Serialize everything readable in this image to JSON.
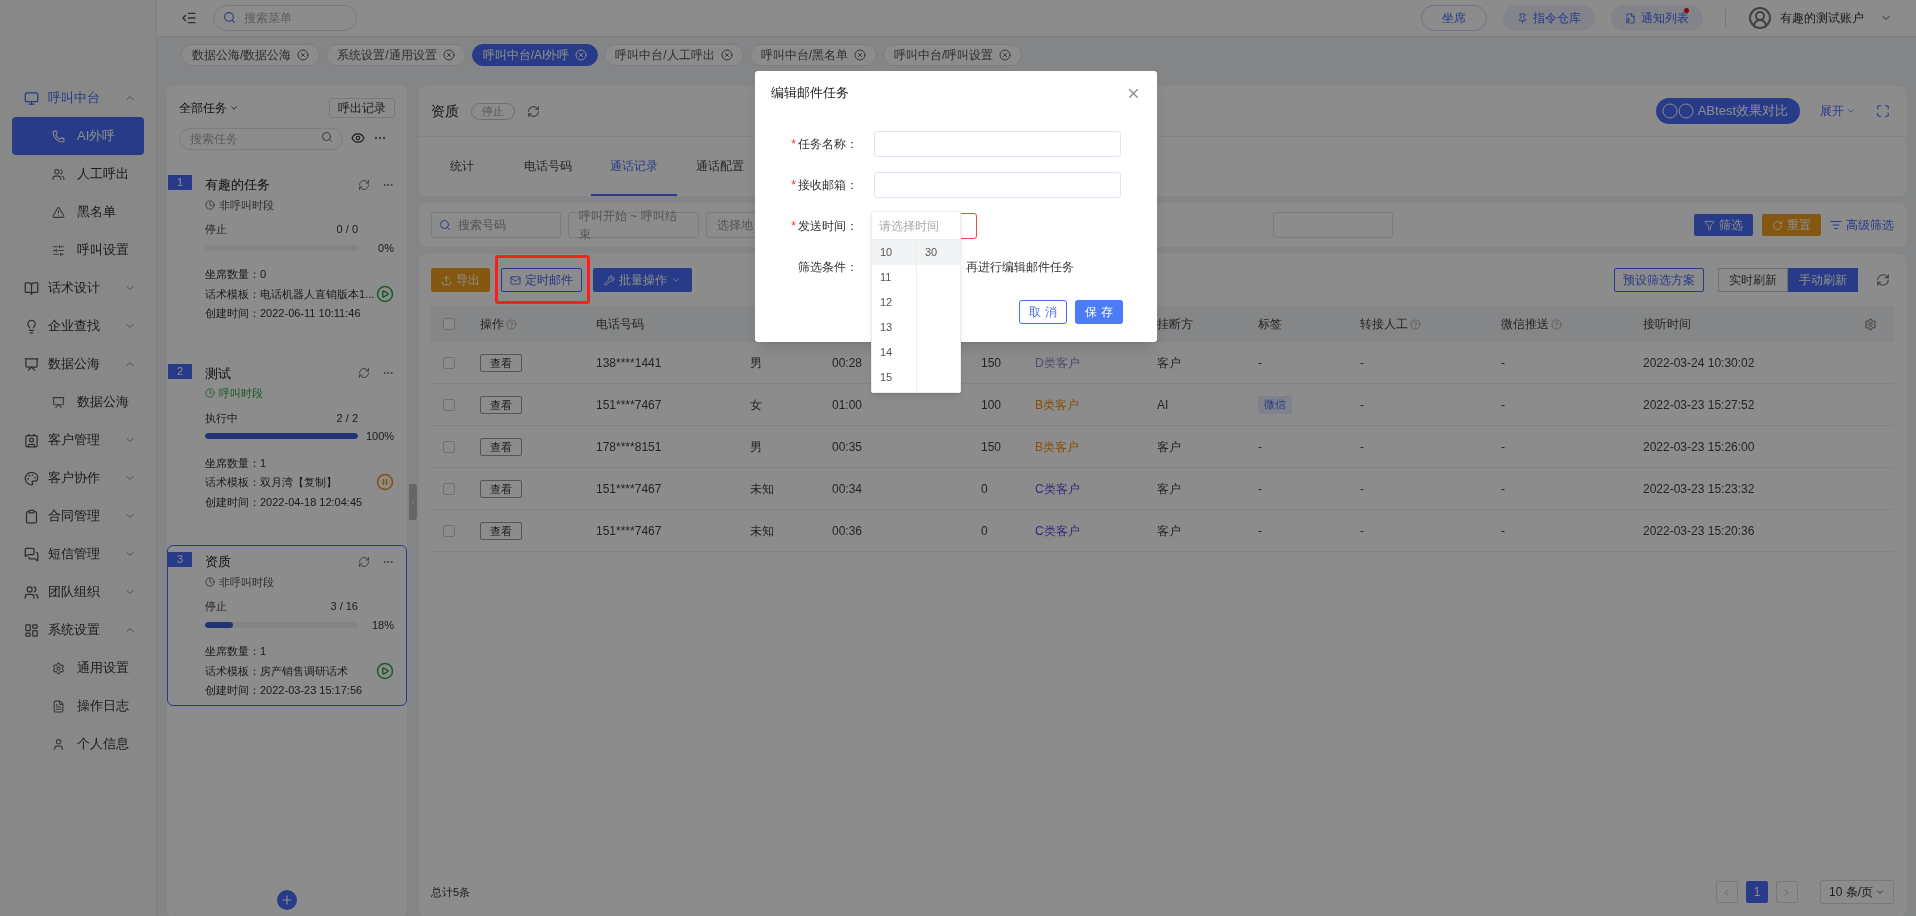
{
  "topbar": {
    "search_placeholder": "搜索菜单",
    "buttons": [
      {
        "label": "坐席",
        "kind": "outline",
        "badge": false
      },
      {
        "label": "指令仓库",
        "kind": "pin",
        "badge": false
      },
      {
        "label": "通知列表",
        "kind": "notice",
        "badge": true
      }
    ],
    "user": "有趣的测试账户"
  },
  "sidebar": {
    "items": [
      {
        "label": "呼叫中台",
        "expanded": true,
        "children": [
          {
            "label": "AI外呼",
            "selected": true
          },
          {
            "label": "人工呼出",
            "selected": false
          },
          {
            "label": "黑名单",
            "selected": false
          },
          {
            "label": "呼叫设置",
            "selected": false
          }
        ]
      },
      {
        "label": "话术设计",
        "expanded": false
      },
      {
        "label": "企业查找",
        "expanded": false
      },
      {
        "label": "数据公海",
        "expanded": true,
        "children": [
          {
            "label": "数据公海",
            "selected": false
          }
        ]
      },
      {
        "label": "客户管理",
        "expanded": false
      },
      {
        "label": "客户协作",
        "expanded": false
      },
      {
        "label": "合同管理",
        "expanded": false
      },
      {
        "label": "短信管理",
        "expanded": false
      },
      {
        "label": "团队组织",
        "expanded": false
      },
      {
        "label": "系统设置",
        "expanded": true,
        "children": [
          {
            "label": "通用设置",
            "selected": false
          },
          {
            "label": "操作日志",
            "selected": false
          },
          {
            "label": "个人信息",
            "selected": false
          }
        ]
      }
    ]
  },
  "tags": [
    {
      "label": "数据公海/数据公海",
      "selected": false
    },
    {
      "label": "系统设置/通用设置",
      "selected": false
    },
    {
      "label": "呼叫中台/AI外呼",
      "selected": true
    },
    {
      "label": "呼叫中台/人工呼出",
      "selected": false
    },
    {
      "label": "呼叫中台/黑名单",
      "selected": false
    },
    {
      "label": "呼叫中台/呼叫设置",
      "selected": false
    }
  ],
  "task_panel": {
    "filter": "全部任务",
    "record_button": "呼出记录",
    "search_placeholder": "搜索任务",
    "tasks": [
      {
        "index": "1",
        "name": "有趣的任务",
        "period": "非呼叫时段",
        "in_period": false,
        "status": "停止",
        "progress": "0 / 0",
        "level": 0,
        "percent": "0%",
        "details": [
          "坐席数量：0",
          "话术模板：电话机器人直销版本1...",
          "创建时间：2022-06-11 10:11:46"
        ],
        "running": false,
        "selected": false
      },
      {
        "index": "2",
        "name": "测试",
        "period": "呼叫时段",
        "in_period": true,
        "status": "执行中",
        "progress": "2 / 2",
        "level": 1,
        "percent": "100%",
        "details": [
          "坐席数量：1",
          "话术模板：双月湾【复制】",
          "创建时间：2022-04-18 12:04:45"
        ],
        "running": true,
        "selected": false
      },
      {
        "index": "3",
        "name": "资质",
        "period": "非呼叫时段",
        "in_period": false,
        "status": "停止",
        "progress": "3 / 16",
        "level": 0.18,
        "percent": "18%",
        "details": [
          "坐席数量：1",
          "话术模板：房产销售调研话术",
          "创建时间：2022-03-23 15:17:56"
        ],
        "running": false,
        "selected": true
      }
    ]
  },
  "main": {
    "title": "资质",
    "status": "停止",
    "ab_button": "ABtest效果对比",
    "expand": "展开",
    "tabs": [
      {
        "label": "统计",
        "selected": false
      },
      {
        "label": "电话号码",
        "selected": false
      },
      {
        "label": "通话记录",
        "selected": true
      },
      {
        "label": "通话配置",
        "selected": false
      }
    ],
    "filters": {
      "search_placeholder": "搜索号码",
      "date_range": "呼叫开始 ~ 呼叫结束",
      "region": "选择地",
      "filter_button": "筛选",
      "reset_button": "重置",
      "advanced": "高级筛选"
    },
    "toolbar": {
      "export": "导出",
      "scheduled_mail": "定时邮件",
      "batch": "批量操作",
      "preset": "预设筛选方案",
      "refresh_modes": [
        {
          "label": "实时刷新",
          "selected": false
        },
        {
          "label": "手动刷新",
          "selected": true
        }
      ]
    },
    "table": {
      "select_all": {
        "checked": false
      },
      "columns": [
        {
          "label": "操作",
          "help": true
        },
        {
          "label": "电话号码",
          "help": false
        },
        {
          "label": "挂断方",
          "help": false
        },
        {
          "label": "标签",
          "help": false
        },
        {
          "label": "转接人工",
          "help": true
        },
        {
          "label": "微信推送",
          "help": true
        },
        {
          "label": "接听时间",
          "help": false
        }
      ],
      "rows": [
        {
          "checked": false,
          "action": "查看",
          "phone": "138****1441",
          "gender": "男",
          "duration": "00:28",
          "column_5": "150",
          "customer_type": {
            "label": "D类客户",
            "kind": "d"
          },
          "hangup": "客户",
          "tag": {
            "text": "-",
            "kind": "plain"
          },
          "transfer": "-",
          "wechat": "-",
          "time": "2022-03-24 10:30:02"
        },
        {
          "checked": false,
          "action": "查看",
          "phone": "151****7467",
          "gender": "女",
          "duration": "01:00",
          "column_5": "100",
          "customer_type": {
            "label": "B类客户",
            "kind": "b"
          },
          "hangup": "AI",
          "tag": {
            "text": "微信",
            "kind": "badge"
          },
          "transfer": "-",
          "wechat": "-",
          "time": "2022-03-23 15:27:52"
        },
        {
          "checked": false,
          "action": "查看",
          "phone": "178****8151",
          "gender": "男",
          "duration": "00:35",
          "column_5": "150",
          "customer_type": {
            "label": "B类客户",
            "kind": "b"
          },
          "hangup": "客户",
          "tag": {
            "text": "-",
            "kind": "plain"
          },
          "transfer": "-",
          "wechat": "-",
          "time": "2022-03-23 15:26:00"
        },
        {
          "checked": false,
          "action": "查看",
          "phone": "151****7467",
          "gender": "未知",
          "duration": "00:34",
          "column_5": "0",
          "customer_type": {
            "label": "C类客户",
            "kind": "c"
          },
          "hangup": "客户",
          "tag": {
            "text": "-",
            "kind": "plain"
          },
          "transfer": "-",
          "wechat": "-",
          "time": "2022-03-23 15:23:32"
        },
        {
          "checked": false,
          "action": "查看",
          "phone": "151****7467",
          "gender": "未知",
          "duration": "00:36",
          "column_5": "0",
          "customer_type": {
            "label": "C类客户",
            "kind": "c"
          },
          "hangup": "客户",
          "tag": {
            "text": "-",
            "kind": "plain"
          },
          "transfer": "-",
          "wechat": "-",
          "time": "2022-03-23 15:20:36"
        }
      ]
    },
    "footer": {
      "total": "总计5条",
      "pages": [
        {
          "label": "1",
          "selected": true
        }
      ],
      "page_size": "10 条/页"
    }
  },
  "modal": {
    "title": "编辑邮件任务",
    "fields": [
      {
        "mark": "*",
        "label": "任务名称：",
        "kind": "input"
      },
      {
        "mark": "*",
        "label": "接收邮箱：",
        "kind": "input"
      },
      {
        "mark": "*",
        "label": "发送时间：",
        "kind": "time",
        "invalid": true
      },
      {
        "label": "筛选条件：",
        "kind": "note",
        "text": "再进行编辑邮件任务"
      }
    ],
    "time_picker": {
      "placeholder": "请选择时间",
      "hours": [
        {
          "label": "10",
          "selected": true
        },
        {
          "label": "11",
          "selected": false
        },
        {
          "label": "12",
          "selected": false
        },
        {
          "label": "13",
          "selected": false
        },
        {
          "label": "14",
          "selected": false
        },
        {
          "label": "15",
          "selected": false
        }
      ],
      "minutes": [
        {
          "label": "30",
          "selected": true
        }
      ]
    },
    "cancel": "取 消",
    "save": "保 存"
  }
}
